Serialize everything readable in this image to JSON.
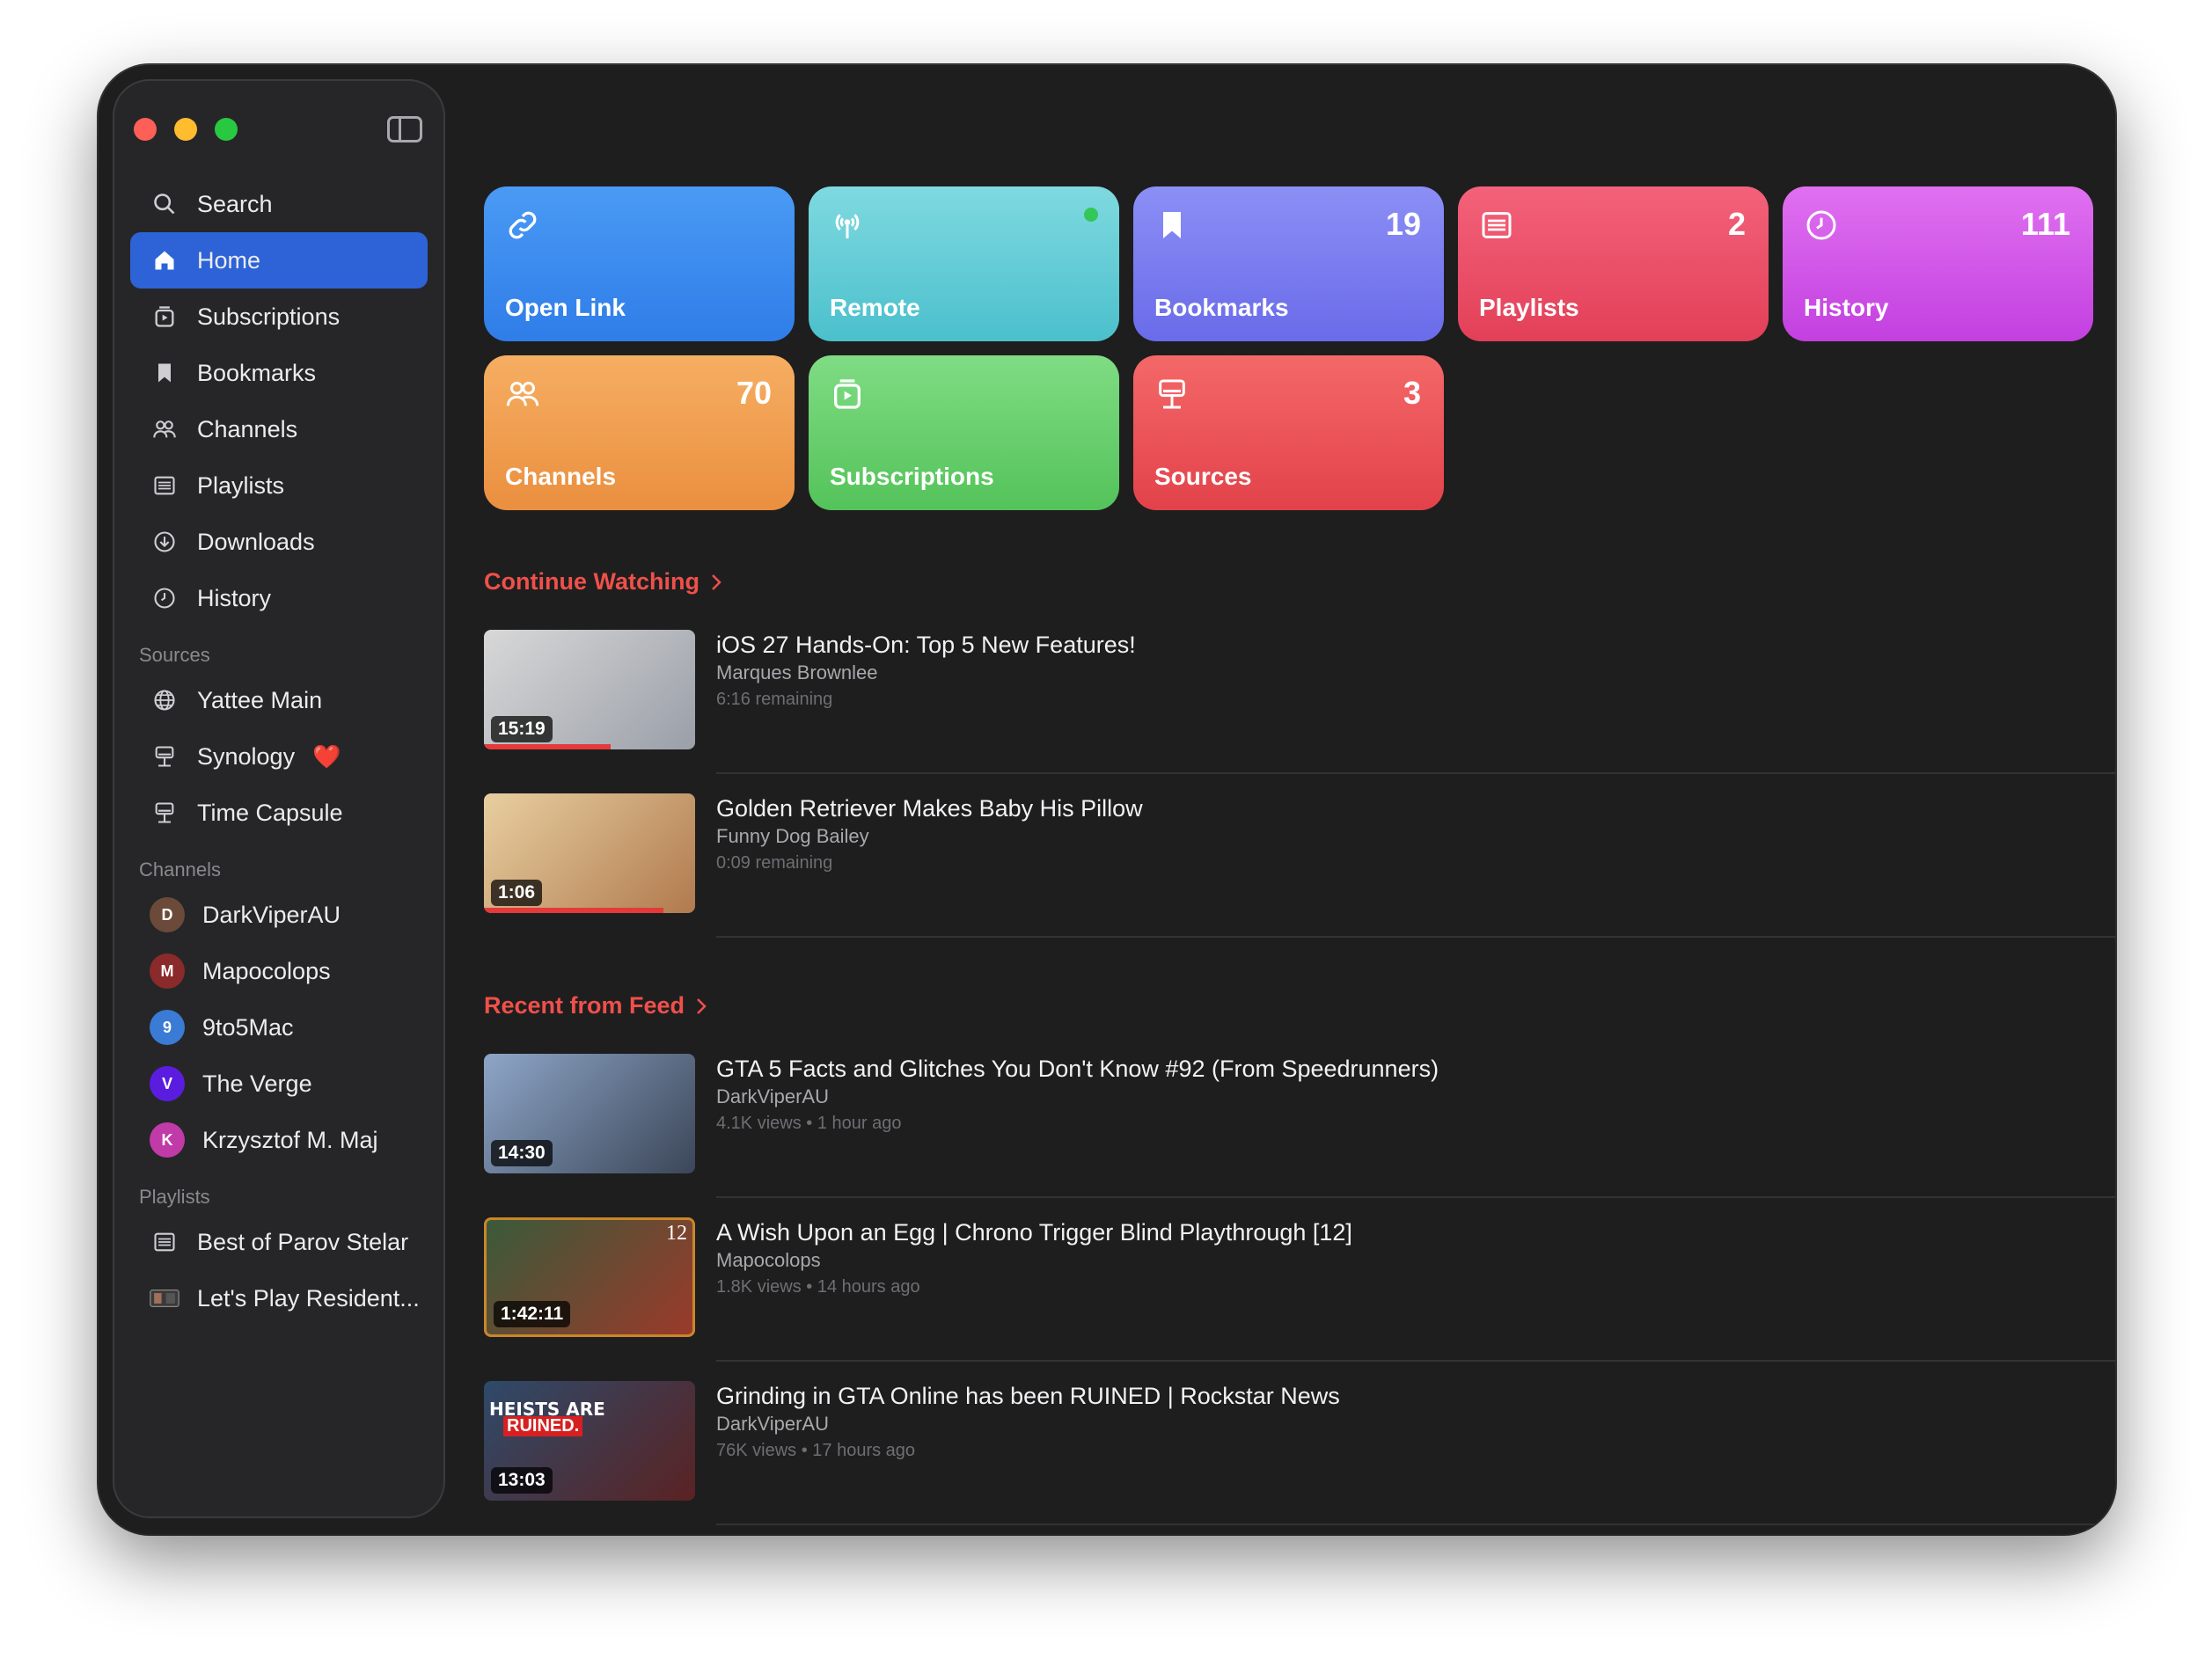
{
  "sidebar": {
    "nav": [
      {
        "label": "Search",
        "icon": "search-icon"
      },
      {
        "label": "Home",
        "icon": "home-icon",
        "active": true
      },
      {
        "label": "Subscriptions",
        "icon": "subscriptions-icon"
      },
      {
        "label": "Bookmarks",
        "icon": "bookmark-icon"
      },
      {
        "label": "Channels",
        "icon": "people-icon"
      },
      {
        "label": "Playlists",
        "icon": "list-icon"
      },
      {
        "label": "Downloads",
        "icon": "download-icon"
      },
      {
        "label": "History",
        "icon": "clock-icon"
      }
    ],
    "sources_title": "Sources",
    "sources": [
      {
        "label": "Yattee Main",
        "icon": "globe-icon"
      },
      {
        "label": "Synology",
        "icon": "server-icon",
        "emoji": "❤️"
      },
      {
        "label": "Time Capsule",
        "icon": "server-icon"
      }
    ],
    "channels_title": "Channels",
    "channels": [
      {
        "label": "DarkViperAU",
        "color": "#6b4a3a",
        "initial": "D"
      },
      {
        "label": "Mapocolops",
        "color": "#8a2a2a",
        "initial": "M"
      },
      {
        "label": "9to5Mac",
        "color": "#3a7bd5",
        "initial": "9"
      },
      {
        "label": "The Verge",
        "color": "#5a1de0",
        "initial": "V"
      },
      {
        "label": "Krzysztof M. Maj",
        "color": "#c03aa8",
        "initial": "K"
      }
    ],
    "playlists_title": "Playlists",
    "playlists": [
      {
        "label": "Best of Parov Stelar",
        "icon": "list-icon"
      },
      {
        "label": "Let's Play Resident...",
        "icon": "playlist-thumb-icon"
      }
    ]
  },
  "tiles": [
    {
      "label": "Open Link",
      "count": "",
      "icon": "link-icon",
      "color_a": "#4a9af5",
      "color_b": "#2f7de8"
    },
    {
      "label": "Remote",
      "count": "",
      "icon": "antenna-icon",
      "color_a": "#7fd9e0",
      "color_b": "#4bc0cc",
      "dot": "#33c759"
    },
    {
      "label": "Bookmarks",
      "count": "19",
      "icon": "bookmark-icon",
      "color_a": "#8b8ff5",
      "color_b": "#6a6be9"
    },
    {
      "label": "Playlists",
      "count": "2",
      "icon": "list-icon",
      "color_a": "#f3627a",
      "color_b": "#e24058"
    },
    {
      "label": "History",
      "count": "111",
      "icon": "clock-icon",
      "color_a": "#e070f0",
      "color_b": "#c340e0"
    },
    {
      "label": "Channels",
      "count": "70",
      "icon": "people-icon",
      "color_a": "#f6ae62",
      "color_b": "#ea8f3f"
    },
    {
      "label": "Subscriptions",
      "count": "",
      "icon": "subscriptions-icon",
      "color_a": "#7fdc83",
      "color_b": "#54c35a"
    },
    {
      "label": "Sources",
      "count": "3",
      "icon": "server-icon",
      "color_a": "#f46868",
      "color_b": "#e2424a"
    }
  ],
  "continue_watching": {
    "title": "Continue Watching",
    "videos": [
      {
        "title": "iOS 27 Hands-On: Top 5 New Features!",
        "channel": "Marques Brownlee",
        "meta": "6:16 remaining",
        "duration": "15:19",
        "progress": 0.6,
        "thumb_a": "#d8d8d8",
        "thumb_b": "#9a9fa8"
      },
      {
        "title": "Golden Retriever Makes Baby His Pillow",
        "channel": "Funny Dog Bailey",
        "meta": "0:09 remaining",
        "duration": "1:06",
        "progress": 0.85,
        "thumb_a": "#e8cfa0",
        "thumb_b": "#b07a4e"
      }
    ]
  },
  "recent_feed": {
    "title": "Recent from Feed",
    "videos": [
      {
        "title": "GTA 5 Facts and Glitches You Don't Know #92 (From Speedrunners)",
        "channel": "DarkViperAU",
        "meta": "4.1K views  •  1 hour ago",
        "duration": "14:30",
        "thumb_a": "#8ea6c8",
        "thumb_b": "#3b4658"
      },
      {
        "title": "A Wish Upon an Egg | Chrono Trigger Blind Playthrough [12]",
        "channel": "Mapocolops",
        "meta": "1.8K views  •  14 hours ago",
        "duration": "1:42:11",
        "badge": "12",
        "thumb_a": "#3a5a3a",
        "thumb_b": "#9a3a2a"
      },
      {
        "title": "Grinding in GTA Online has been RUINED | Rockstar News",
        "channel": "DarkViperAU",
        "meta": "76K views  •  17 hours ago",
        "duration": "13:03",
        "overlay_title": "HEISTS ARE",
        "overlay_sub": "RUINED.",
        "thumb_a": "#2e4a6a",
        "thumb_b": "#5a2222"
      }
    ]
  }
}
